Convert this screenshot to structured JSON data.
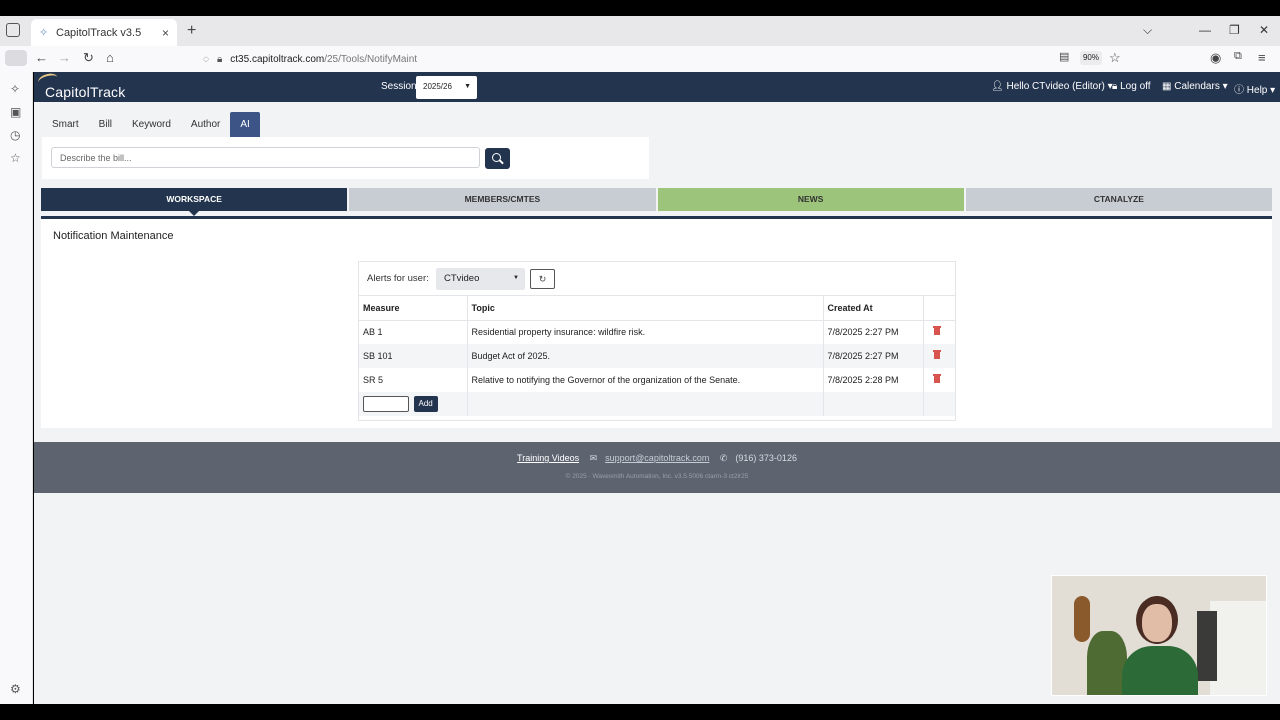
{
  "browser": {
    "tab_title": "CapitolTrack v3.5",
    "tab_close": "×",
    "new_tab": "+",
    "url_host": "ct35.capitoltrack.com",
    "url_path": "/25/Tools/NotifyMaint",
    "zoom": "90%"
  },
  "app": {
    "logo": "CapitolTrack",
    "session_label": "Session:",
    "session_value": "2025/26",
    "user_greeting": "Hello CTvideo (Editor)",
    "logoff": "Log off",
    "calendars": "Calendars",
    "help": "Help"
  },
  "search": {
    "tabs": [
      "Smart",
      "Bill",
      "Keyword",
      "Author",
      "AI"
    ],
    "active_tab": "AI",
    "ai_placeholder": "Describe the bill..."
  },
  "main_tabs": [
    "WORKSPACE",
    "MEMBERS/CMTES",
    "NEWS",
    "CTANALYZE"
  ],
  "panel": {
    "title": "Notification Maintenance",
    "alerts_label": "Alerts for user:",
    "user_value": "CTvideo",
    "columns": [
      "Measure",
      "Topic",
      "Created At",
      ""
    ],
    "rows": [
      {
        "measure": "AB 1",
        "topic": "Residential property insurance: wildfire risk.",
        "created": "7/8/2025 2:27 PM"
      },
      {
        "measure": "SB 101",
        "topic": "Budget Act of 2025.",
        "created": "7/8/2025 2:27 PM"
      },
      {
        "measure": "SR 5",
        "topic": "Relative to notifying the Governor of the organization of the Senate.",
        "created": "7/8/2025 2:28 PM"
      }
    ],
    "add_label": "Add"
  },
  "footer": {
    "training": "Training Videos",
    "email": "support@capitoltrack.com",
    "phone": "(916) 373-0126",
    "copyright": "© 2025 · Wavesmith Automation, Inc. v3.5.5006 ctarm-3 ct2lr25"
  },
  "colors": {
    "nav": "#23344e",
    "news_tab": "#9cc47a",
    "delete": "#d9534f",
    "ai_tab": "#3d5486"
  }
}
